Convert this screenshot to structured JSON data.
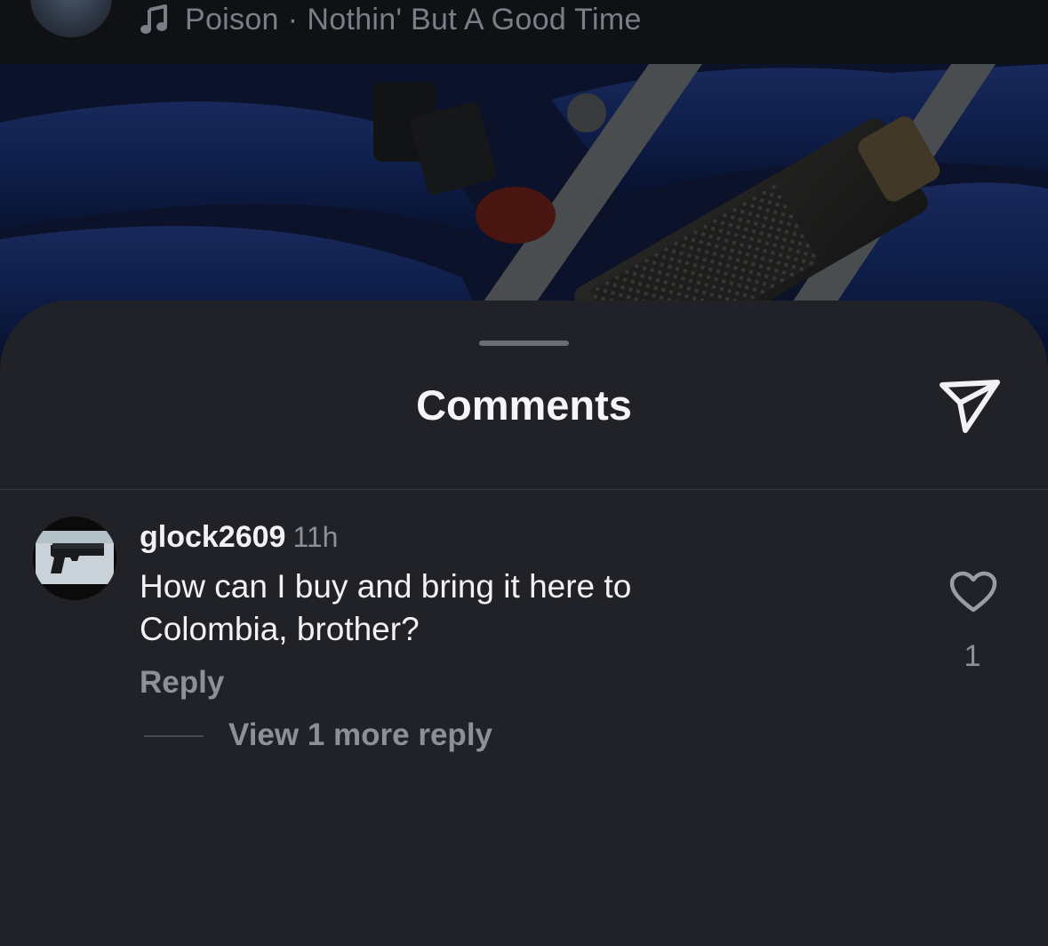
{
  "audio_bar": {
    "artist": "Poison",
    "separator": "·",
    "track": "Nothin' But A Good Time",
    "icon": "music-note-icon"
  },
  "comments_sheet": {
    "title": "Comments",
    "share_icon": "send-paper-plane-icon"
  },
  "comments": [
    {
      "username": "glock2609",
      "time": "11h",
      "text": "How can I buy and bring it here to Colombia, brother?",
      "reply_label": "Reply",
      "like_icon": "heart-outline-icon",
      "like_count": "1",
      "view_replies_label": "View 1 more reply"
    }
  ],
  "colors": {
    "sheet_background": "#212227",
    "primary_text": "#f2f2f4",
    "secondary_text": "#8e9098",
    "post_blue": "#1d3a8c"
  }
}
